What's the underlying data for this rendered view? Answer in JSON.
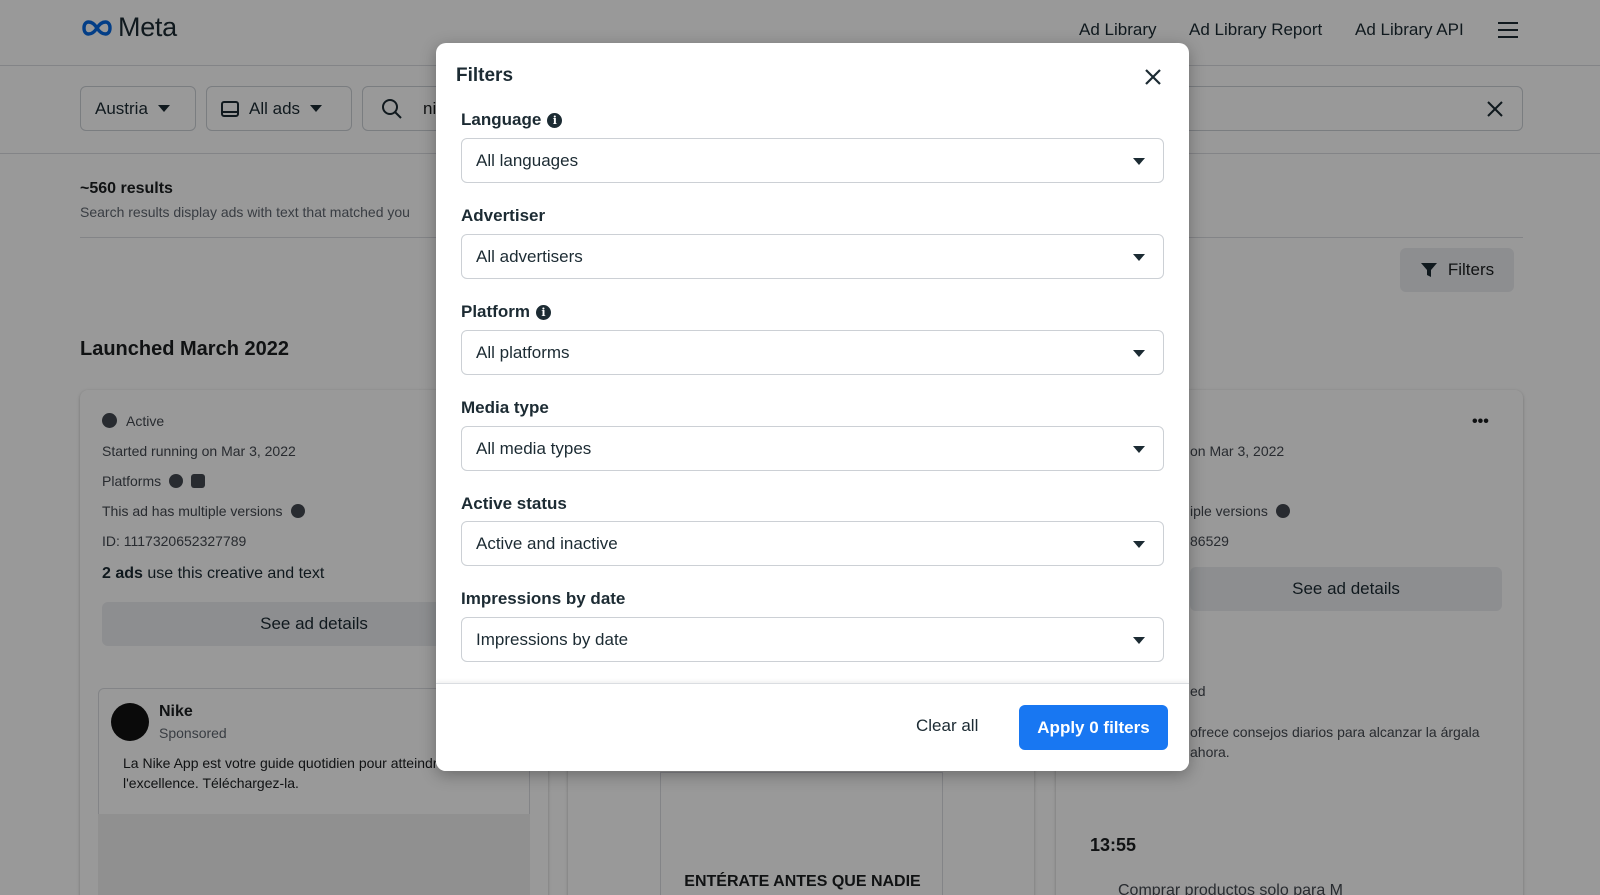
{
  "header": {
    "logo_text": "Meta",
    "nav": [
      "Ad Library",
      "Ad Library Report",
      "Ad Library API"
    ]
  },
  "search": {
    "country": "Austria",
    "ad_type": "All ads",
    "query": "ni"
  },
  "results": {
    "count": "~560 results",
    "note": "Search results display ads with text that matched you",
    "filters_label": "Filters",
    "launched": "Launched March 2022"
  },
  "card_left": {
    "status": "Active",
    "started": "Started running on Mar 3, 2022",
    "platforms": "Platforms",
    "versions": "This ad has multiple versions",
    "id": "ID: 1117320652327789",
    "ads_count": "2 ads",
    "ads_text": " use this creative and text",
    "see_details": "See ad details",
    "advertiser": "Nike",
    "sponsored": "Sponsored",
    "body": "La Nike App est votre guide quotidien pour atteindre l'excellence. Téléchargez-la."
  },
  "card_mid": {
    "image_text": "ENTÉRATE ANTES QUE NADIE"
  },
  "card_right": {
    "started": "on Mar 3, 2022",
    "versions": "iple versions",
    "id": "86529",
    "see_details": "See ad details",
    "status_frag": "ed",
    "body": "ofrece consejos diarios para alcanzar la árgala ahora.",
    "phone_time": "13:55",
    "phone_bar": "Comprar productos solo para M"
  },
  "modal": {
    "title": "Filters",
    "fields": [
      {
        "label": "Language",
        "value": "All languages"
      },
      {
        "label": "Advertiser",
        "value": "All advertisers"
      },
      {
        "label": "Platform",
        "value": "All platforms"
      },
      {
        "label": "Media type",
        "value": "All media types"
      },
      {
        "label": "Active status",
        "value": "Active and inactive"
      },
      {
        "label": "Impressions by date",
        "value": "Impressions by date"
      }
    ],
    "clear_label": "Clear all",
    "apply_label": "Apply 0 filters"
  },
  "colors": {
    "accent": "#1877f2",
    "text": "#1c2b33",
    "overlay": "rgba(0,0,0,0.4)"
  }
}
